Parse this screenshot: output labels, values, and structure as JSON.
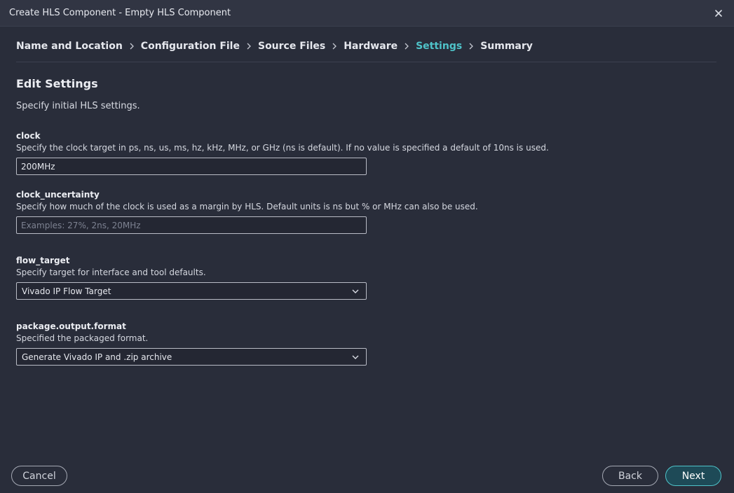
{
  "window": {
    "title": "Create HLS Component - Empty HLS Component",
    "close_icon": "close-icon"
  },
  "steps": [
    {
      "label": "Name and Location",
      "active": false
    },
    {
      "label": "Configuration File",
      "active": false
    },
    {
      "label": "Source Files",
      "active": false
    },
    {
      "label": "Hardware",
      "active": false
    },
    {
      "label": "Settings",
      "active": true
    },
    {
      "label": "Summary",
      "active": false
    }
  ],
  "page": {
    "title": "Edit Settings",
    "subtitle": "Specify initial HLS settings."
  },
  "fields": {
    "clock": {
      "label": "clock",
      "description": "Specify the clock target in ps, ns, us, ms, hz, kHz, MHz, or GHz (ns is default). If no value is specified a default of 10ns is used.",
      "value": "200MHz",
      "placeholder": ""
    },
    "clock_uncertainty": {
      "label": "clock_uncertainty",
      "description": "Specify how much of the clock is used as a margin by HLS. Default units is ns but % or MHz can also be used.",
      "value": "",
      "placeholder": "Examples: 27%, 2ns, 20MHz"
    },
    "flow_target": {
      "label": "flow_target",
      "description": "Specify target for interface and tool defaults.",
      "selected": "Vivado IP Flow Target"
    },
    "package_output_format": {
      "label": "package.output.format",
      "description": "Specified the packaged format.",
      "selected": "Generate Vivado IP and .zip archive"
    }
  },
  "buttons": {
    "cancel": "Cancel",
    "back": "Back",
    "next": "Next"
  },
  "colors": {
    "background": "#292d3a",
    "titlebar": "#313543",
    "accent": "#4fc3c9",
    "primary_button": "#1e4a57"
  }
}
